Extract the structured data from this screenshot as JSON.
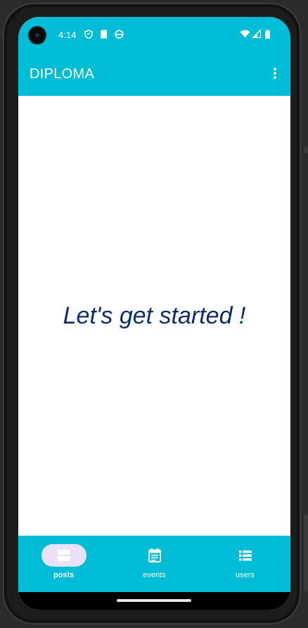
{
  "status_bar": {
    "time": "4:14",
    "icons": [
      "shield-icon",
      "sd-card-icon",
      "android-head-icon",
      "wifi-icon",
      "signal-icon",
      "battery-icon"
    ]
  },
  "app_bar": {
    "title": "DIPLOMA",
    "menu_icon": "more-vert-icon"
  },
  "main": {
    "headline": "Let's get started !"
  },
  "bottom_nav": {
    "items": [
      {
        "label": "posts",
        "icon": "posts-icon",
        "active": true
      },
      {
        "label": "events",
        "icon": "calendar-icon",
        "active": false
      },
      {
        "label": "users",
        "icon": "list-icon",
        "active": false
      }
    ]
  },
  "colors": {
    "accent": "#00bcd4",
    "headline": "#0d2c6b",
    "active_pill": "#e8e0f6"
  }
}
